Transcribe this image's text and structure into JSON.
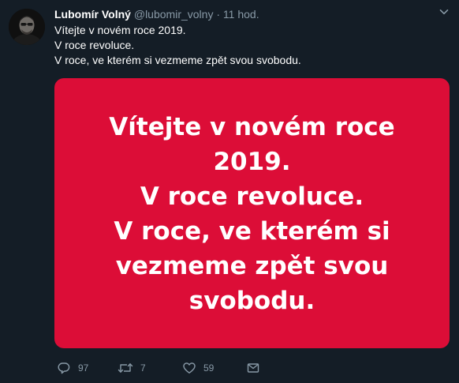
{
  "author": {
    "name": "Lubomír Volný",
    "handle": "@lubomir_volny",
    "separator": "·",
    "time": "11 hod."
  },
  "tweet": {
    "lines": [
      "Vítejte v novém roce 2019.",
      "V roce revoluce.",
      "V roce, ve kterém si vezmeme zpět svou svobodu."
    ]
  },
  "media": {
    "background": "#dc0d37",
    "lines": [
      "Vítejte v novém roce",
      "2019.",
      "V roce revoluce.",
      "V roce, ve kterém si",
      "vezmeme zpět svou",
      "svobodu."
    ]
  },
  "actions": {
    "reply_count": "97",
    "retweet_count": "7",
    "like_count": "59"
  },
  "icons": {
    "reply": "reply-icon",
    "retweet": "retweet-icon",
    "like": "heart-icon",
    "dm": "envelope-icon",
    "menu": "chevron-down-icon"
  },
  "colors": {
    "background": "#141d26",
    "secondary_text": "#8899a6",
    "media": "#dc0d37"
  }
}
